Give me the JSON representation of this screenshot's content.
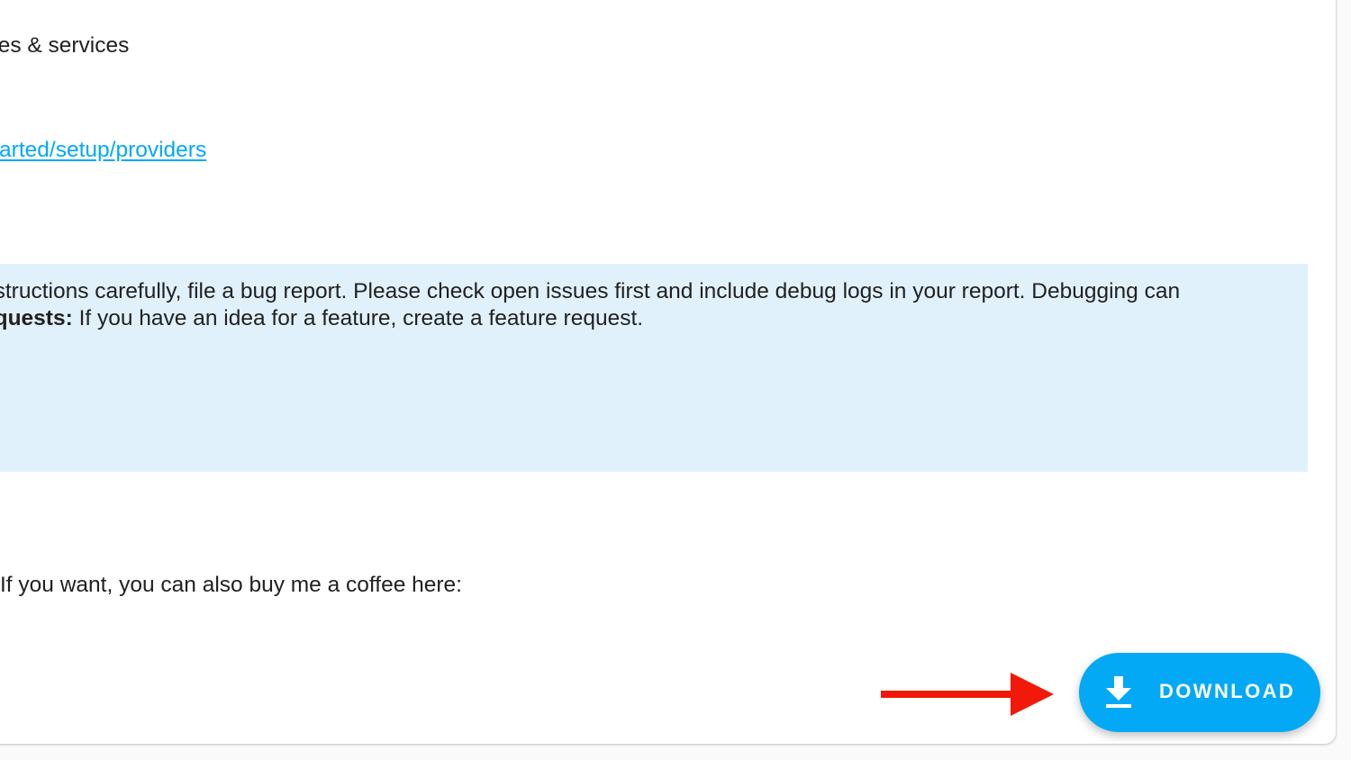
{
  "content": {
    "heading_fragment": "ices & services",
    "link_fragment": "started/setup/providers",
    "info": {
      "line1": "nstructions carefully, file a bug report. Please check open issues first and include debug logs in your report. Debugging can",
      "line2_bold": "equests:",
      "line2_rest": " If you have an idea for a feature, create a feature request."
    },
    "coffee_text": "If you want, you can also buy me a coffee here:"
  },
  "fab": {
    "label": "DOWNLOAD",
    "icon": "download-icon"
  },
  "annotation": {
    "arrow_icon": "right-arrow-icon",
    "arrow_color": "#f0190a"
  },
  "colors": {
    "accent": "#03a9f4",
    "info_background": "#e1f1fc",
    "text": "#212121"
  }
}
